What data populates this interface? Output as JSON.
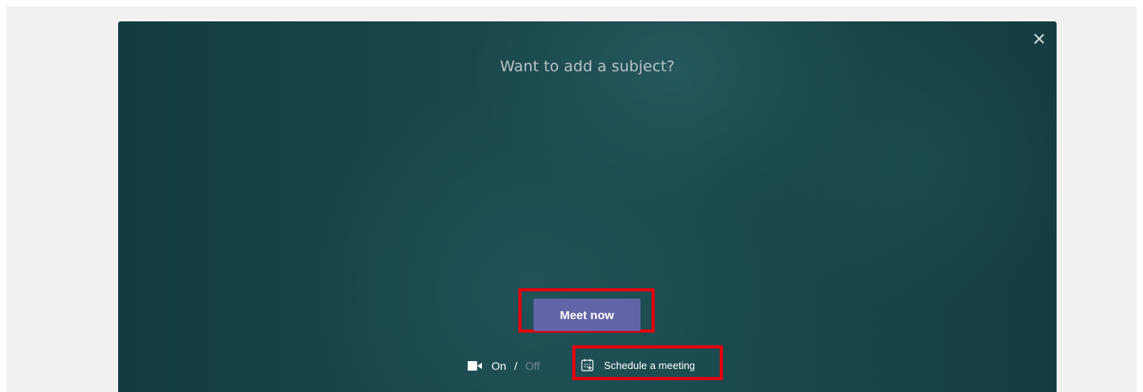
{
  "dialog": {
    "subject_prompt": "Want to add a subject?",
    "meet_now_label": "Meet now",
    "video": {
      "on_label": "On",
      "separator": "/",
      "off_label": "Off",
      "state": "on"
    },
    "schedule_label": "Schedule a meeting",
    "icons": {
      "close": "close-icon",
      "camera": "video-camera-icon",
      "schedule": "calendar-add-icon"
    },
    "colors": {
      "accent": "#6264a7",
      "highlight": "#e3000f",
      "background": "#1a474b"
    }
  }
}
